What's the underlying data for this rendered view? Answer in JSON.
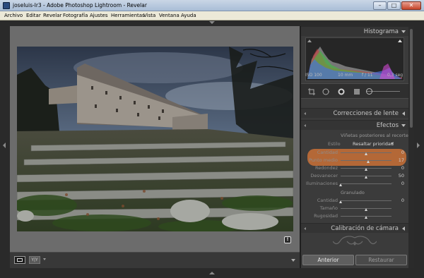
{
  "window": {
    "title": "joseluis-lr3 - Adobe Photoshop Lightroom - Revelar",
    "controls": {
      "minimize": "–",
      "maximize": "□",
      "close": "✕"
    }
  },
  "menu": [
    "Archivo",
    "Editar",
    "Revelar",
    "Fotografía",
    "Ajustes",
    "Herramientas",
    "Vista",
    "Ventana",
    "Ayuda"
  ],
  "panel": {
    "histogram": {
      "title": "Histograma",
      "iso": "ISO 100",
      "focal": "10 mm",
      "aperture": "f / 11",
      "shutter": "0,3 seg"
    },
    "lens_corrections": {
      "title": "Correcciones de lente"
    },
    "effects": {
      "title": "Efectos",
      "vignette_heading": "Viñetas posteriores al recorte",
      "style_label": "Estilo",
      "style_value": "Resaltar prioridad",
      "sliders": [
        {
          "label": "Cantidad",
          "value": "0",
          "fraction": 0.5
        },
        {
          "label": "Punto medio",
          "value": "17",
          "fraction": 0.55
        },
        {
          "label": "Redondez",
          "value": "0",
          "fraction": 0.5
        },
        {
          "label": "Desvanecer",
          "value": "50",
          "fraction": 0.5
        },
        {
          "label": "Iluminaciones",
          "value": "0",
          "fraction": 0.0
        }
      ],
      "grain_heading": "Granulado",
      "grain_sliders": [
        {
          "label": "Cantidad",
          "value": "0",
          "fraction": 0.0
        },
        {
          "label": "Tamaño",
          "value": "",
          "fraction": 0.5
        },
        {
          "label": "Rugosidad",
          "value": "",
          "fraction": 0.5
        }
      ]
    },
    "camera_calibration": {
      "title": "Calibración de cámara"
    },
    "buttons": {
      "previous": "Anterior",
      "reset": "Restaurar"
    }
  },
  "canvas": {
    "info_icon": "!"
  },
  "toolbar": {
    "compare_label": "Y|Y"
  },
  "colors": {
    "highlight": "#d67436",
    "panel_bg": "#3b3b3b",
    "canvas_bg": "#6c6c6c"
  },
  "icons": [
    "app-icon",
    "crop-icon",
    "spot-removal-icon",
    "red-eye-icon",
    "graduated-filter-icon",
    "adjustment-brush-icon",
    "info-icon",
    "ornament-icon"
  ]
}
